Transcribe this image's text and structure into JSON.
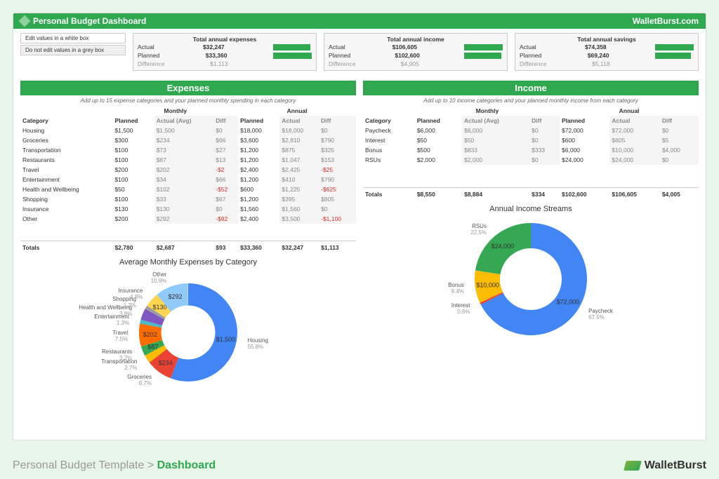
{
  "header": {
    "title": "Personal Budget Dashboard",
    "site": "WalletBurst.com"
  },
  "legend": {
    "edit": "Edit values in a white box",
    "noedit": "Do not edit values in a grey box"
  },
  "summaries": [
    {
      "title": "Total annual expenses",
      "actual_label": "Actual",
      "actual": "$32,247",
      "actual_pct": 97,
      "planned_label": "Planned",
      "planned": "$33,360",
      "planned_pct": 100,
      "diff_label": "Difference",
      "diff": "$1,113"
    },
    {
      "title": "Total annual income",
      "actual_label": "Actual",
      "actual": "$106,605",
      "actual_pct": 100,
      "planned_label": "Planned",
      "planned": "$102,600",
      "planned_pct": 96,
      "diff_label": "Difference",
      "diff": "$4,005"
    },
    {
      "title": "Total annual savings",
      "actual_label": "Actual",
      "actual": "$74,358",
      "actual_pct": 100,
      "planned_label": "Planned",
      "planned": "$69,240",
      "planned_pct": 93,
      "diff_label": "Difference",
      "diff": "$5,118"
    }
  ],
  "expenses": {
    "title": "Expenses",
    "help": "Add up to 15 expense categories and your planned monthly spending in each category",
    "cols": {
      "category": "Category",
      "monthly": "Monthly",
      "annual": "Annual",
      "planned": "Planned",
      "actual_avg": "Actual (Avg)",
      "actual": "Actual",
      "diff": "Diff"
    },
    "rows": [
      {
        "cat": "Housing",
        "mp": "$1,500",
        "ma": "$1,500",
        "md": "$0",
        "ap": "$18,000",
        "aa": "$18,000",
        "ad": "$0"
      },
      {
        "cat": "Groceries",
        "mp": "$300",
        "ma": "$234",
        "md": "$66",
        "ap": "$3,600",
        "aa": "$2,810",
        "ad": "$790"
      },
      {
        "cat": "Transportation",
        "mp": "$100",
        "ma": "$73",
        "md": "$27",
        "ap": "$1,200",
        "aa": "$875",
        "ad": "$325"
      },
      {
        "cat": "Restaurants",
        "mp": "$100",
        "ma": "$87",
        "md": "$13",
        "ap": "$1,200",
        "aa": "$1,047",
        "ad": "$153"
      },
      {
        "cat": "Travel",
        "mp": "$200",
        "ma": "$202",
        "md": "-$2",
        "md_neg": true,
        "ap": "$2,400",
        "aa": "$2,425",
        "ad": "-$25",
        "ad_neg": true
      },
      {
        "cat": "Entertainment",
        "mp": "$100",
        "ma": "$34",
        "md": "$66",
        "ap": "$1,200",
        "aa": "$410",
        "ad": "$790"
      },
      {
        "cat": "Health and Wellbeing",
        "mp": "$50",
        "ma": "$102",
        "md": "-$52",
        "md_neg": true,
        "ap": "$600",
        "aa": "$1,225",
        "ad": "-$625",
        "ad_neg": true
      },
      {
        "cat": "Shopping",
        "mp": "$100",
        "ma": "$33",
        "md": "$67",
        "ap": "$1,200",
        "aa": "$395",
        "ad": "$805"
      },
      {
        "cat": "Insurance",
        "mp": "$130",
        "ma": "$130",
        "md": "$0",
        "ap": "$1,560",
        "aa": "$1,560",
        "ad": "$0"
      },
      {
        "cat": "Other",
        "mp": "$200",
        "ma": "$292",
        "md": "-$92",
        "md_neg": true,
        "ap": "$2,400",
        "aa": "$3,500",
        "ad": "-$1,100",
        "ad_neg": true
      }
    ],
    "totals": {
      "label": "Totals",
      "mp": "$2,780",
      "ma": "$2,687",
      "md": "$93",
      "ap": "$33,360",
      "aa": "$32,247",
      "ad": "$1,113"
    }
  },
  "income": {
    "title": "Income",
    "help": "Add up to 10 income categories and your planned monthly income from each category",
    "rows": [
      {
        "cat": "Paycheck",
        "mp": "$6,000",
        "ma": "$6,000",
        "md": "$0",
        "ap": "$72,000",
        "aa": "$72,000",
        "ad": "$0"
      },
      {
        "cat": "Interest",
        "mp": "$50",
        "ma": "$50",
        "md": "$0",
        "ap": "$600",
        "aa": "$605",
        "ad": "$5"
      },
      {
        "cat": "Bonus",
        "mp": "$500",
        "ma": "$833",
        "md": "$333",
        "ap": "$6,000",
        "aa": "$10,000",
        "ad": "$4,000"
      },
      {
        "cat": "RSUs",
        "mp": "$2,000",
        "ma": "$2,000",
        "md": "$0",
        "ap": "$24,000",
        "aa": "$24,000",
        "ad": "$0"
      }
    ],
    "totals": {
      "label": "Totals",
      "mp": "$8,550",
      "ma": "$8,884",
      "md": "$334",
      "ap": "$102,600",
      "aa": "$106,605",
      "ad": "$4,005"
    }
  },
  "chart_data": [
    {
      "type": "pie",
      "title": "Average Monthly Expenses by Category",
      "series": [
        {
          "name": "Housing",
          "value": 1500,
          "pct": 55.8,
          "label": "$1,500",
          "color": "#4285f4"
        },
        {
          "name": "Groceries",
          "value": 234,
          "pct": 8.7,
          "label": "$234",
          "color": "#ea4335"
        },
        {
          "name": "Transportation",
          "value": 73,
          "pct": 2.7,
          "label": "",
          "color": "#fbbc04"
        },
        {
          "name": "Restaurants",
          "value": 87,
          "pct": 3.2,
          "label": "$87",
          "color": "#34a853"
        },
        {
          "name": "Travel",
          "value": 202,
          "pct": 7.5,
          "label": "$202",
          "color": "#ff6d01"
        },
        {
          "name": "Entertainment",
          "value": 34,
          "pct": 1.3,
          "label": "",
          "color": "#46bdc6"
        },
        {
          "name": "Health and Wellbeing",
          "value": 102,
          "pct": 3.8,
          "label": "",
          "color": "#7e57c2"
        },
        {
          "name": "Shopping",
          "value": 33,
          "pct": 1.2,
          "label": "",
          "color": "#9e9e9e"
        },
        {
          "name": "Insurance",
          "value": 130,
          "pct": 4.8,
          "label": "$130",
          "color": "#ffd54f"
        },
        {
          "name": "Other",
          "value": 292,
          "pct": 10.9,
          "label": "$292",
          "color": "#90caf9"
        }
      ]
    },
    {
      "type": "pie",
      "title": "Annual Income Streams",
      "series": [
        {
          "name": "Paycheck",
          "value": 72000,
          "pct": 67.5,
          "label": "$72,000",
          "color": "#4285f4"
        },
        {
          "name": "Interest",
          "value": 605,
          "pct": 0.6,
          "label": "",
          "color": "#ea4335"
        },
        {
          "name": "Bonus",
          "value": 10000,
          "pct": 9.4,
          "label": "$10,000",
          "color": "#fbbc04"
        },
        {
          "name": "RSUs",
          "value": 24000,
          "pct": 22.5,
          "label": "$24,000",
          "color": "#34a853"
        }
      ]
    }
  ],
  "footer": {
    "crumb_pre": "Personal Budget Template > ",
    "crumb_active": "Dashboard",
    "logo": "WalletBurst"
  }
}
